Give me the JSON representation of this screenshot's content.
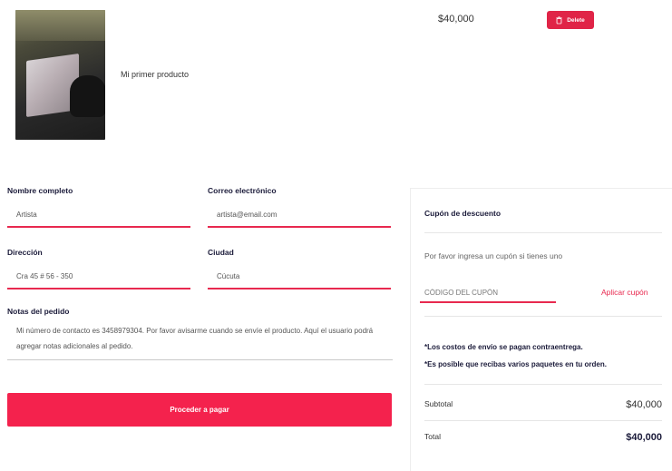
{
  "cart": {
    "item": {
      "name": "Mi primer producto",
      "price": "$40,000",
      "delete_label": "Delete"
    }
  },
  "form": {
    "full_name": {
      "label": "Nombre completo",
      "value": "Artista"
    },
    "email": {
      "label": "Correo electrónico",
      "value": "artista@email.com"
    },
    "address": {
      "label": "Dirección",
      "value": "Cra 45 # 56 - 350"
    },
    "city": {
      "label": "Ciudad",
      "value": "Cúcuta"
    },
    "notes": {
      "label": "Notas del pedido",
      "value": "Mi número de contacto es 3458979304. Por favor avisarme cuando se envíe el producto. Aquí el usuario podrá agregar notas adicionales al pedido."
    },
    "submit_label": "Proceder a pagar"
  },
  "summary": {
    "coupon_title": "Cupón de descuento",
    "coupon_hint": "Por favor ingresa un cupón si tienes uno",
    "coupon_placeholder": "CÓDIGO DEL CUPÓN",
    "apply_coupon_label": "Aplicar cupón",
    "notice_shipping": "*Los costos de envío se pagan contraentrega.",
    "notice_packages": "*Es posible que recibas varios paquetes en tu orden.",
    "subtotal_label": "Subtotal",
    "subtotal_value": "$40,000",
    "total_label": "Total",
    "total_value": "$40,000"
  },
  "colors": {
    "accent": "#f4224d",
    "delete_button": "#e02447",
    "text_dark": "#1b1b3a"
  },
  "icons": {
    "delete": "trash-icon"
  }
}
